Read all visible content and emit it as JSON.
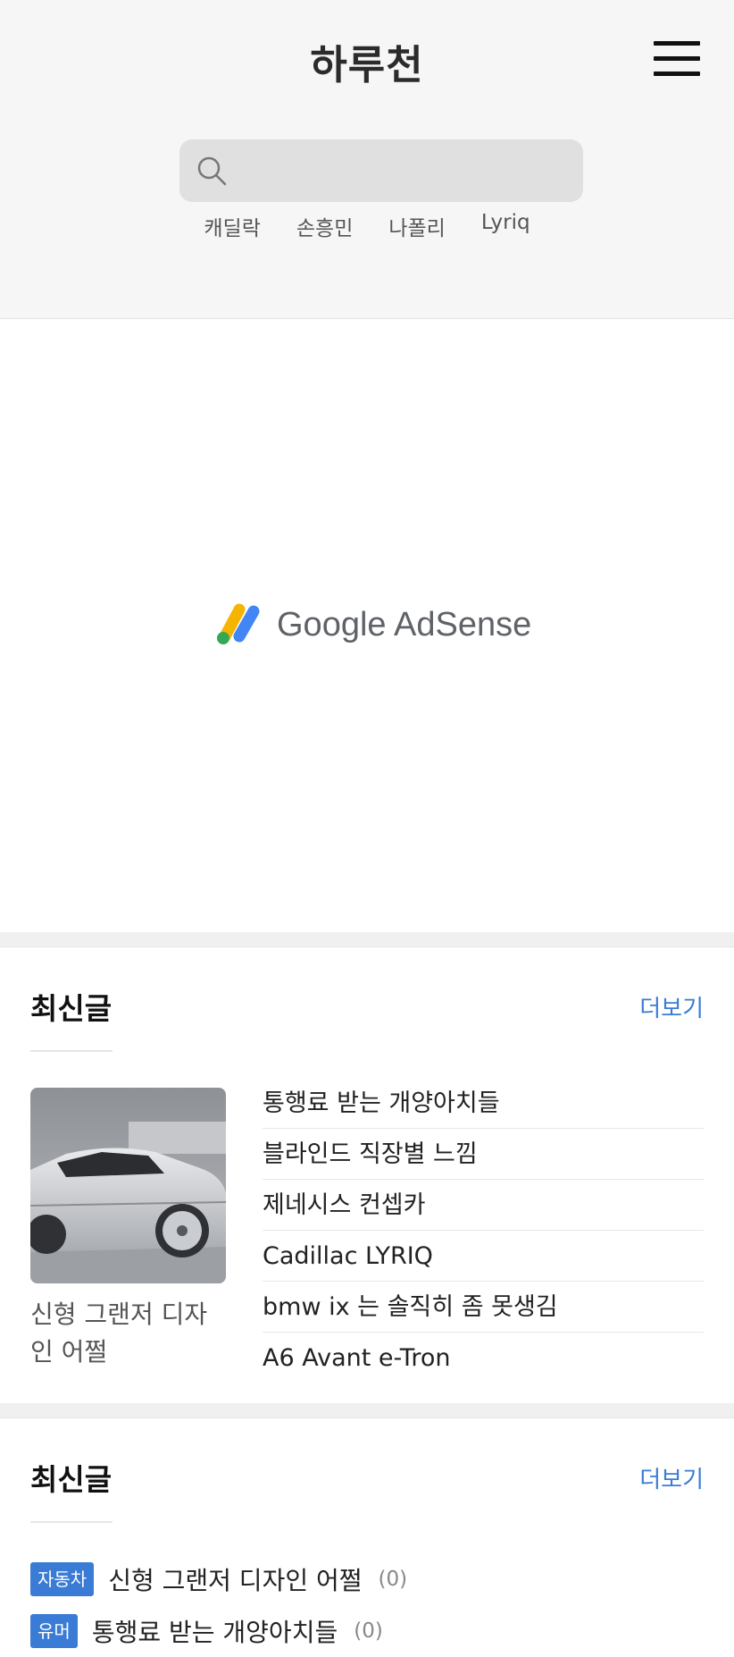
{
  "header": {
    "site_title": "하루천",
    "search": {
      "placeholder": "",
      "value": ""
    },
    "tags": [
      "캐딜락",
      "손흥민",
      "나폴리",
      "Lyriq"
    ]
  },
  "ad": {
    "label": "Google AdSense"
  },
  "recent_posts": {
    "title": "최신글",
    "more_label": "더보기",
    "featured": {
      "caption": "신형 그랜저 디자인 어쩔"
    },
    "items": [
      "통행료 받는 개양아치들",
      "블라인드 직장별 느낌",
      "제네시스 컨셉카",
      "Cadillac LYRIQ",
      "bmw ix 는 솔직히 좀 못생김",
      "A6 Avant e-Tron"
    ]
  },
  "recent_posts_categorized": {
    "title": "최신글",
    "more_label": "더보기",
    "items": [
      {
        "category": "자동차",
        "title": "신형 그랜저 디자인 어쩔",
        "comments": "(0)"
      },
      {
        "category": "유머",
        "title": "통행료 받는 개양아치들",
        "comments": "(0)"
      }
    ]
  },
  "colors": {
    "accent": "#3a7bd5",
    "header_bg": "#f6f6f6",
    "search_bg": "#e0e0e0"
  }
}
